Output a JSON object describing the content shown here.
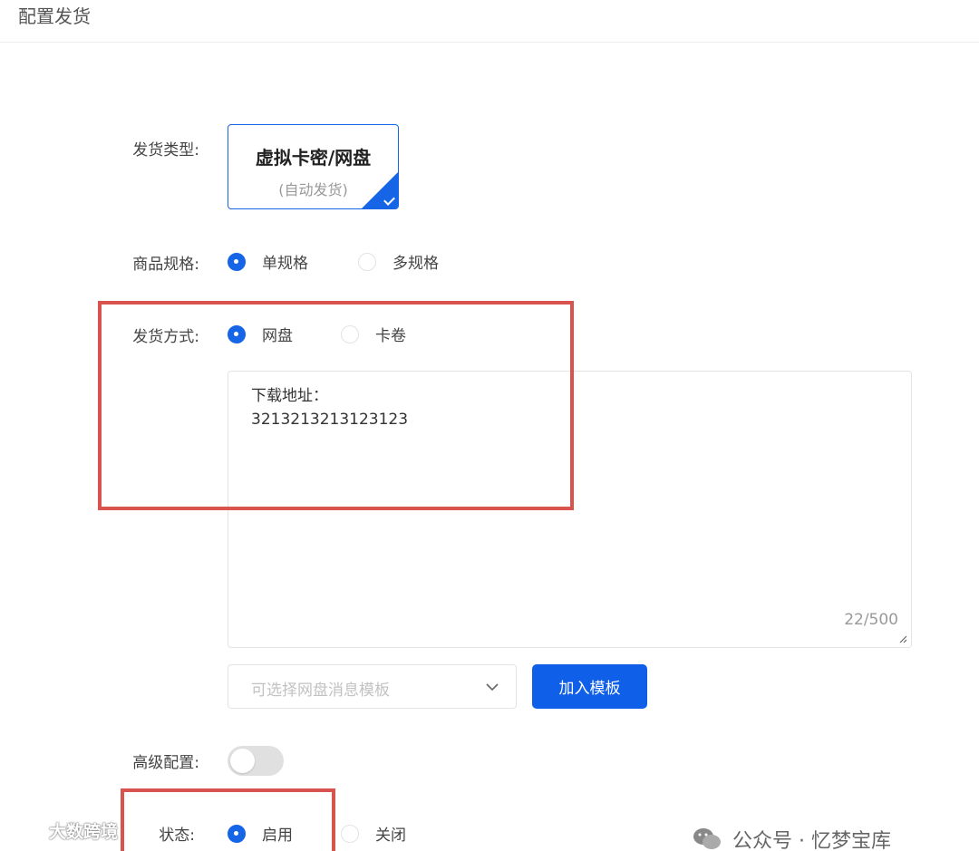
{
  "header": {
    "title": "配置发货"
  },
  "form": {
    "ship_type": {
      "label": "发货类型:",
      "card_title": "虚拟卡密/网盘",
      "card_sub": "(自动发货)"
    },
    "spec": {
      "label": "商品规格:",
      "options": [
        {
          "label": "单规格",
          "checked": true
        },
        {
          "label": "多规格",
          "checked": false
        }
      ]
    },
    "method": {
      "label": "发货方式:",
      "options": [
        {
          "label": "网盘",
          "checked": true
        },
        {
          "label": "卡卷",
          "checked": false
        }
      ]
    },
    "content": {
      "line1": "下载地址：",
      "line2": "3213213213123123",
      "count": "22/500"
    },
    "template_select": {
      "placeholder": "可选择网盘消息模板"
    },
    "add_template_label": "加入模板",
    "advanced": {
      "label": "高级配置:",
      "enabled": false
    },
    "status": {
      "label": "状态:",
      "options": [
        {
          "label": "启用",
          "checked": true
        },
        {
          "label": "关闭",
          "checked": false
        }
      ]
    }
  },
  "watermarks": {
    "left": "大数跨境",
    "right": "公众号 · 忆梦宝库"
  },
  "colors": {
    "primary": "#1565e6",
    "annotation": "#d9534f"
  }
}
